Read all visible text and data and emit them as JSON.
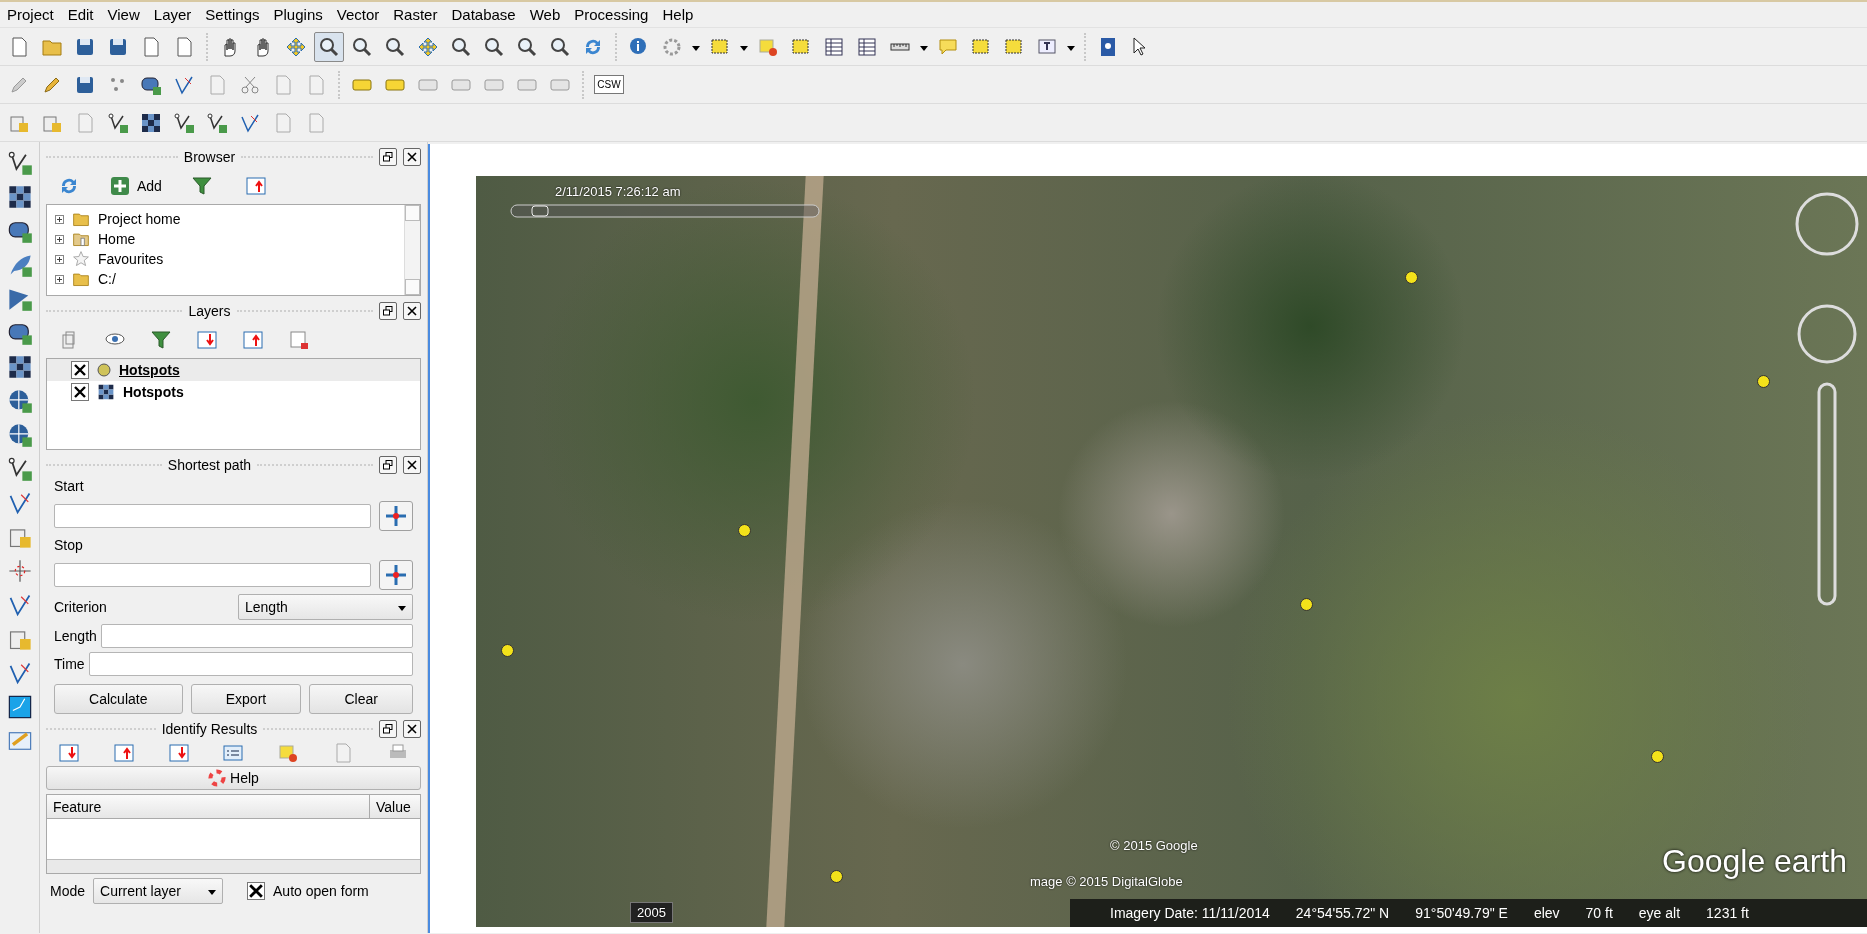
{
  "menu": [
    "Project",
    "Edit",
    "View",
    "Layer",
    "Settings",
    "Plugins",
    "Vector",
    "Raster",
    "Database",
    "Web",
    "Processing",
    "Help"
  ],
  "map_navigation": [
    {
      "selected": false
    },
    {
      "selected": false
    },
    {
      "selected": false
    },
    {
      "selected": true
    },
    {
      "selected": false
    },
    {
      "selected": false
    },
    {
      "selected": false
    },
    {
      "selected": false
    },
    {
      "selected": false
    },
    {
      "selected": false
    },
    {
      "selected": false
    },
    {
      "selected": false
    }
  ],
  "label_toolbar": {
    "csw": "CSW"
  },
  "browser": {
    "title": "Browser",
    "add_label": "Add",
    "items": [
      {
        "label": "Project home",
        "kind": "folder"
      },
      {
        "label": "Home",
        "kind": "home"
      },
      {
        "label": "Favourites",
        "kind": "star"
      },
      {
        "label": "C:/",
        "kind": "folder"
      }
    ]
  },
  "layers": {
    "title": "Layers",
    "items": [
      {
        "name": "Hotspots",
        "kind": "point",
        "checked": true,
        "selected": true
      },
      {
        "name": "Hotspots",
        "kind": "raster",
        "checked": true,
        "selected": false
      }
    ]
  },
  "shortest_path": {
    "title": "Shortest path",
    "start_label": "Start",
    "stop_label": "Stop",
    "criterion_label": "Criterion",
    "criterion_value": "Length",
    "length_label": "Length",
    "time_label": "Time",
    "buttons": [
      "Calculate",
      "Export",
      "Clear"
    ]
  },
  "identify_results": {
    "title": "Identify Results",
    "help_label": "Help",
    "columns": [
      "Feature",
      "Value"
    ],
    "mode_label": "Mode",
    "mode_value": "Current layer",
    "auto_open_form": {
      "label": "Auto open form",
      "checked": true
    }
  },
  "map": {
    "timestamp": "2/11/2015  7:26:12 am",
    "copyright_google": "© 2015 Google",
    "copyright_imagery": "mage © 2015 DigitalGlobe",
    "logo": "Google earth",
    "history_year": "2005",
    "status": [
      "Imagery Date: 11/11/2014",
      "24°54'55.72\" N",
      "91°50'49.79\" E",
      "elev",
      "70 ft",
      "eye alt",
      "1231 ft"
    ]
  }
}
